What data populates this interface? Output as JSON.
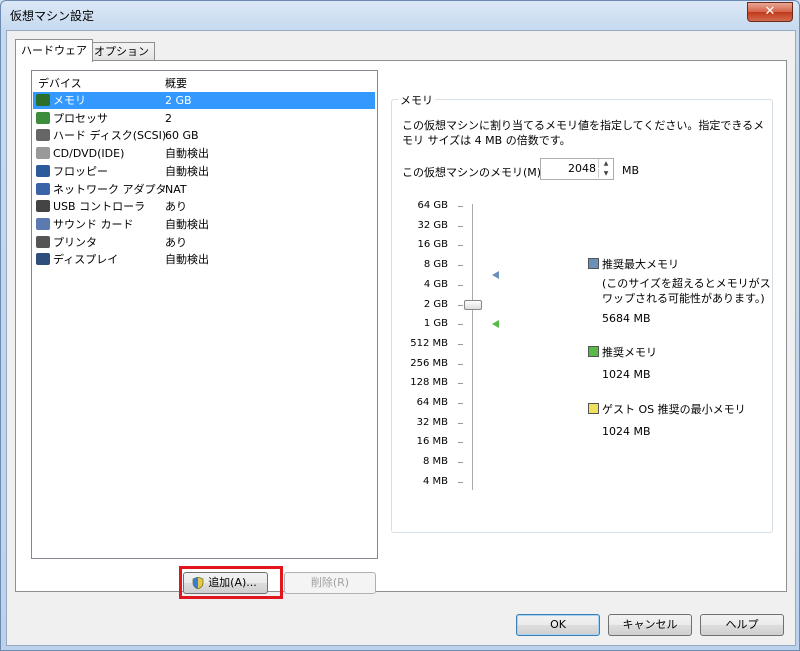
{
  "window": {
    "title": "仮想マシン設定",
    "close": "✕"
  },
  "tabs": [
    {
      "label": "ハードウェア",
      "active": true
    },
    {
      "label": "オプション",
      "active": false
    }
  ],
  "devices": {
    "header": {
      "name": "デバイス",
      "summary": "概要"
    },
    "rows": [
      {
        "name": "メモリ",
        "value": "2 GB",
        "icon": "memory-icon",
        "selected": true
      },
      {
        "name": "プロセッサ",
        "value": "2",
        "icon": "processor-icon"
      },
      {
        "name": "ハード ディスク(SCSI)",
        "value": "60 GB",
        "icon": "hard-disk-icon"
      },
      {
        "name": "CD/DVD(IDE)",
        "value": "自動検出",
        "icon": "cd-dvd-icon"
      },
      {
        "name": "フロッピー",
        "value": "自動検出",
        "icon": "floppy-icon"
      },
      {
        "name": "ネットワーク アダプタ",
        "value": "NAT",
        "icon": "network-adapter-icon"
      },
      {
        "name": "USB コントローラ",
        "value": "あり",
        "icon": "usb-icon"
      },
      {
        "name": "サウンド カード",
        "value": "自動検出",
        "icon": "sound-card-icon"
      },
      {
        "name": "プリンタ",
        "value": "あり",
        "icon": "printer-icon"
      },
      {
        "name": "ディスプレイ",
        "value": "自動検出",
        "icon": "display-icon"
      }
    ]
  },
  "buttons": {
    "add": "追加(A)...",
    "remove": "削除(R)",
    "ok": "OK",
    "cancel": "キャンセル",
    "help": "ヘルプ"
  },
  "memory": {
    "group_title": "メモリ",
    "description": "この仮想マシンに割り当てるメモリ値を指定してください。指定できるメモリ サイズは 4 MB の倍数です。",
    "field_label": "この仮想マシンのメモリ(M):",
    "value": "2048",
    "unit": "MB",
    "scale": [
      "64 GB",
      "32 GB",
      "16 GB",
      "8 GB",
      "4 GB",
      "2 GB",
      "1 GB",
      "512 MB",
      "256 MB",
      "128 MB",
      "64 MB",
      "32 MB",
      "16 MB",
      "8 MB",
      "4 MB"
    ],
    "slider_value_mb": 2048,
    "legend": [
      {
        "label": "推奨最大メモリ",
        "note": "(このサイズを超えるとメモリがスワップされる可能性があります。)",
        "value": "5684 MB",
        "color": "#6a8fb8",
        "icon": "max-memory-marker"
      },
      {
        "label": "推奨メモリ",
        "note": "",
        "value": "1024 MB",
        "color": "#58b848",
        "icon": "recommended-memory-marker"
      },
      {
        "label": "ゲスト OS 推奨の最小メモリ",
        "note": "",
        "value": "1024 MB",
        "color": "#f0e060",
        "icon": "min-memory-marker"
      }
    ]
  },
  "colors": {
    "selection": "#3399ff",
    "highlight_box": "#e0161c"
  }
}
